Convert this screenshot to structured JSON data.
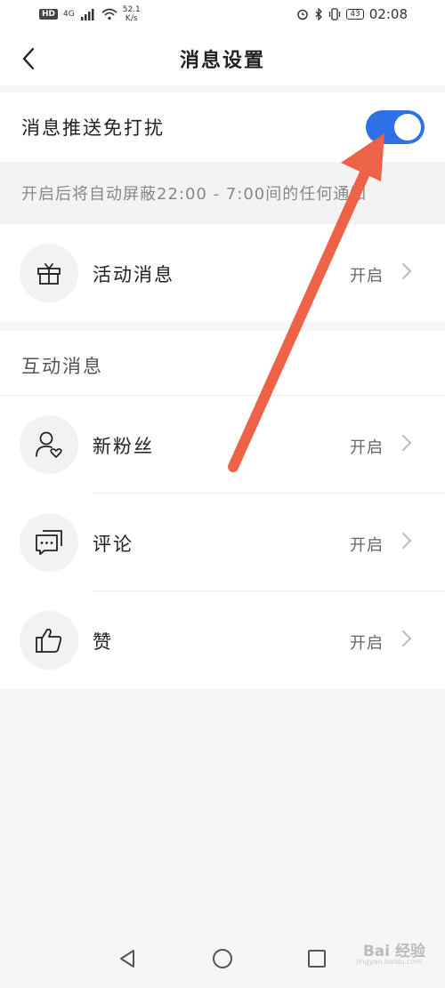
{
  "status_bar": {
    "hd": "HD",
    "network": "4G",
    "speed_value": "52.1",
    "speed_unit": "K/s",
    "battery": "43",
    "time": "02:08"
  },
  "nav": {
    "title": "消息设置"
  },
  "dnd": {
    "label": "消息推送免打扰",
    "enabled": true,
    "hint": "开启后将自动屏蔽22:00 - 7:00间的任何通知"
  },
  "activity": {
    "label": "活动消息",
    "value": "开启",
    "icon": "gift-icon"
  },
  "interaction": {
    "section_title": "互动消息",
    "items": [
      {
        "label": "新粉丝",
        "value": "开启",
        "icon": "person-heart-icon"
      },
      {
        "label": "评论",
        "value": "开启",
        "icon": "comment-icon"
      },
      {
        "label": "赞",
        "value": "开启",
        "icon": "thumbs-up-icon"
      }
    ]
  },
  "colors": {
    "toggle_on": "#2f6fe8",
    "annotation_arrow": "#ee6247"
  },
  "watermark": {
    "brand": "Bai 经验",
    "sub": "jingyan.baidu.com"
  }
}
